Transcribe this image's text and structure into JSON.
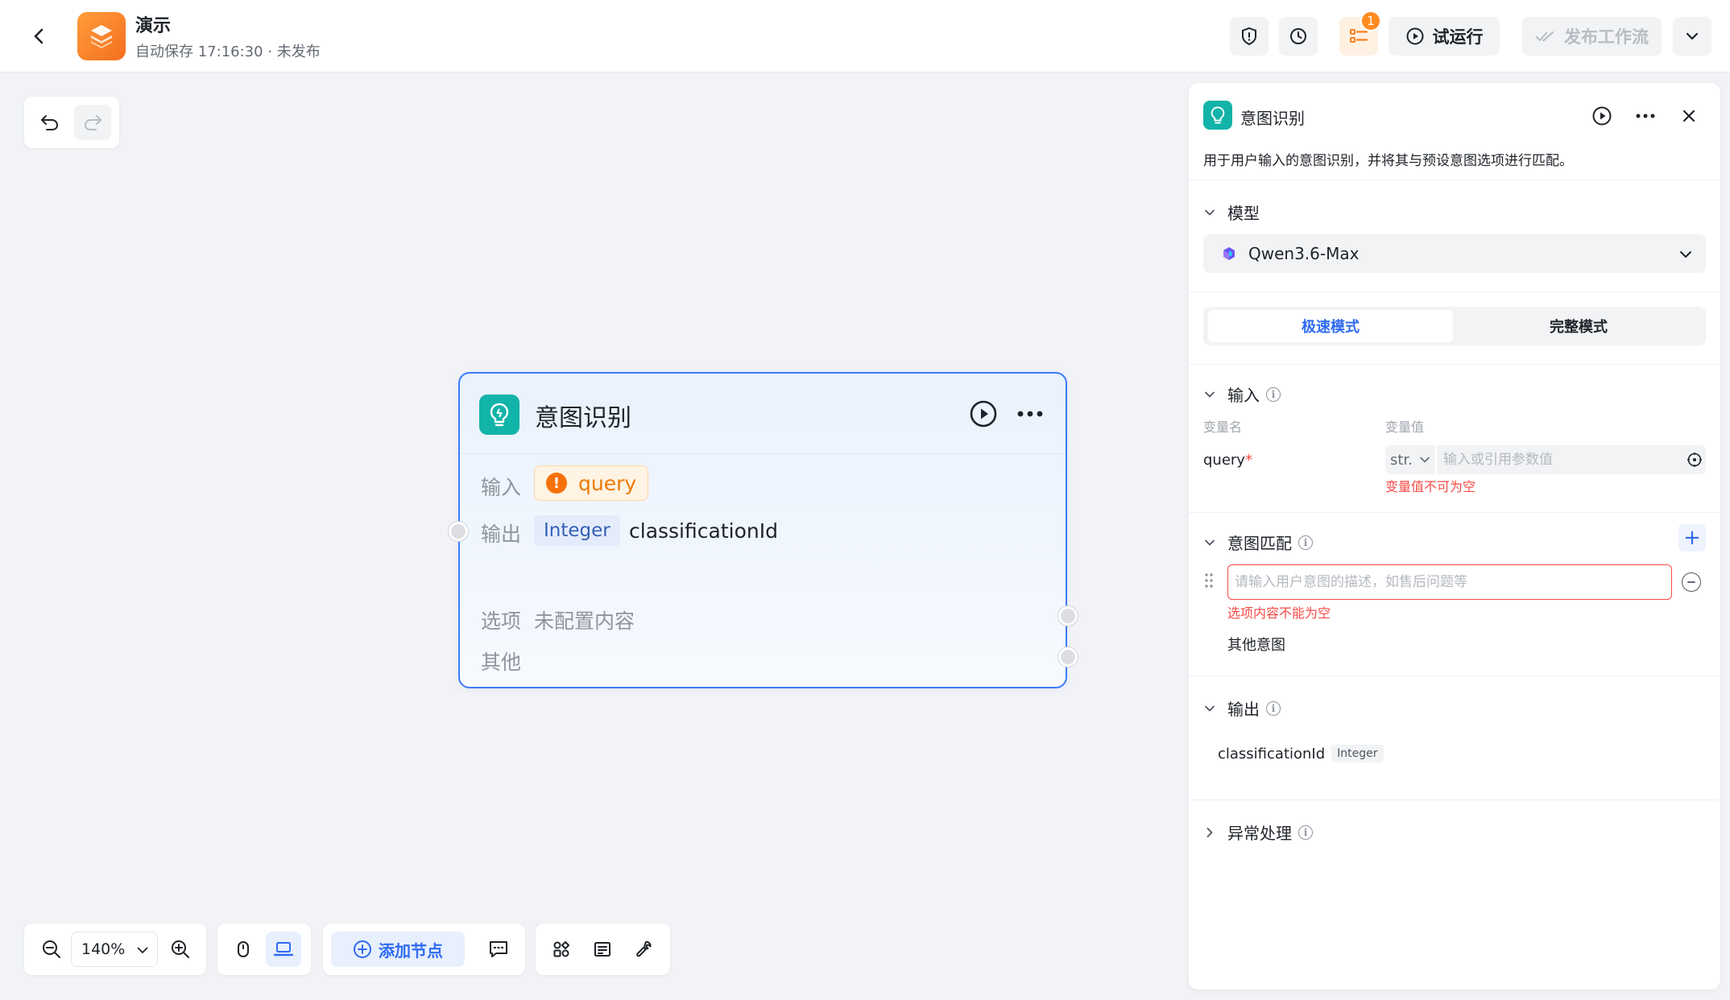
{
  "header": {
    "app_title": "演示",
    "app_subtitle": "自动保存 17:16:30 · 未发布",
    "issues_badge": "1",
    "test_run_label": "试运行",
    "publish_label": "发布工作流"
  },
  "canvas": {
    "zoom": "140%",
    "add_node_label": "添加节点"
  },
  "node": {
    "title": "意图识别",
    "input_label": "输入",
    "input_var": "query",
    "output_label": "输出",
    "output_type": "Integer",
    "output_name": "classificationId",
    "options_label": "选项",
    "options_value": "未配置内容",
    "other_label": "其他"
  },
  "panel": {
    "title": "意图识别",
    "description": "用于用户输入的意图识别，并将其与预设意图选项进行匹配。",
    "model_section": "模型",
    "model_name": "Qwen3.6-Max",
    "mode_fast": "极速模式",
    "mode_full": "完整模式",
    "input_section": "输入",
    "col_var_name": "变量名",
    "col_var_value": "变量值",
    "var_name": "query",
    "required_mark": "*",
    "var_type": "str.",
    "var_value_placeholder": "输入或引用参数值",
    "var_value_error": "变量值不可为空",
    "intent_section": "意图匹配",
    "intent_placeholder": "请输入用户意图的描述，如售后问题等",
    "intent_error": "选项内容不能为空",
    "other_intent": "其他意图",
    "output_section": "输出",
    "output_var": "classificationId",
    "output_type": "Integer",
    "exception_section": "异常处理"
  },
  "colors": {
    "accent": "#2f6bf0",
    "node_border": "#3d7bfa",
    "node_icon": "#12b3a8",
    "warning": "#ec7a06",
    "error": "#f54a45",
    "logo": "#f5801f"
  }
}
